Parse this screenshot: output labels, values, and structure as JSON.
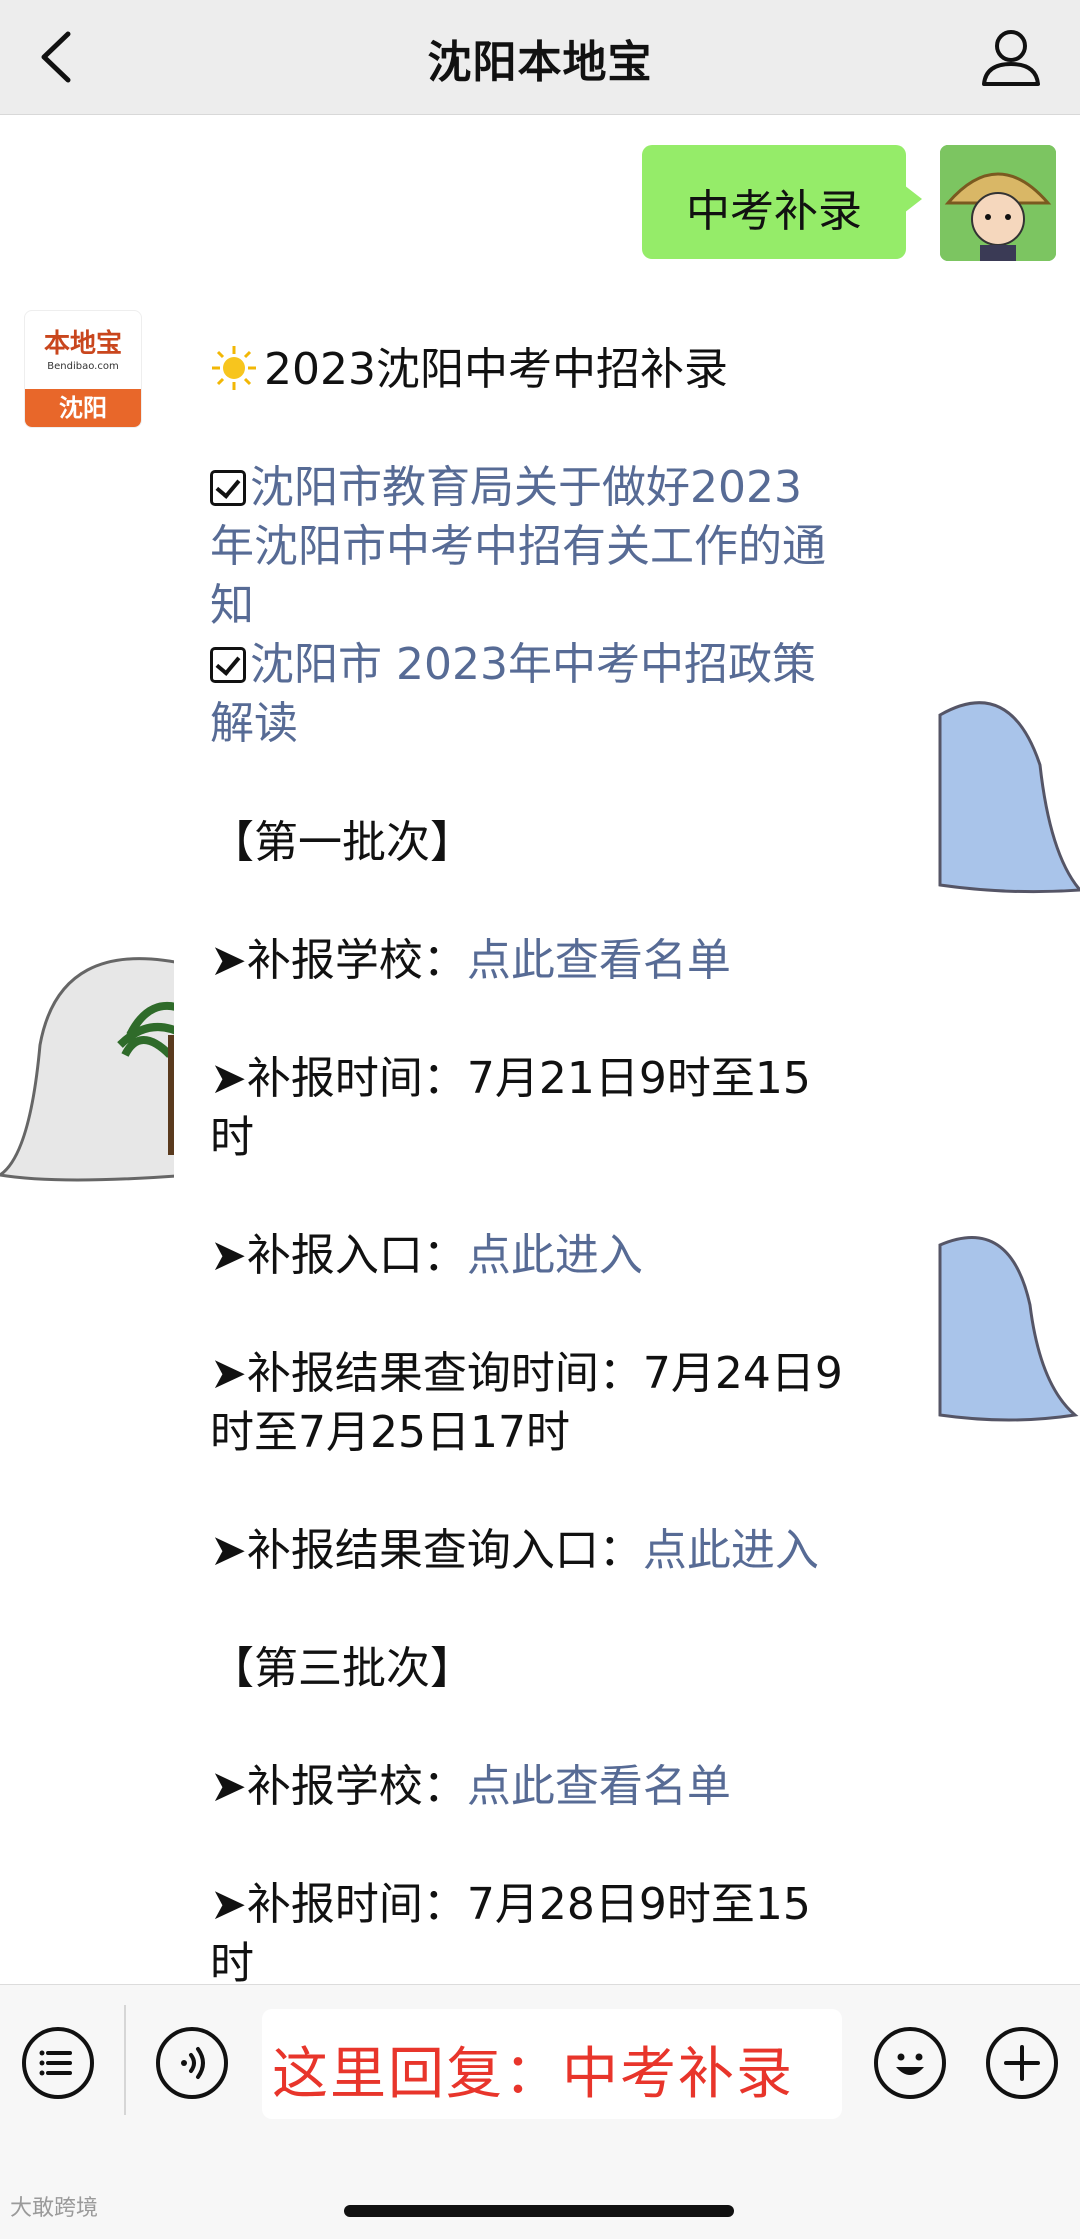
{
  "nav": {
    "title": "沈阳本地宝",
    "back_icon": "chevron-left-icon",
    "profile_icon": "user-icon"
  },
  "outgoing": {
    "text": "中考补录"
  },
  "bot": {
    "brand": "本地宝",
    "url": "Bendibao.com",
    "city": "沈阳"
  },
  "message": {
    "title": "2023沈阳中考中招补录",
    "links": [
      {
        "l1": "沈阳市教育局关于做好2023",
        "l2": "年沈阳市中考中招有关工作的通",
        "l3": "知"
      },
      {
        "l1": "沈阳市 2023年中考中招政策",
        "l2": "解读"
      }
    ],
    "batch1": {
      "header": "【第一批次】",
      "school_label": "➤补报学校：",
      "school_link": "点此查看名单",
      "time_l1": "➤补报时间：7月21日9时至15",
      "time_l2": "时",
      "entry_label": "➤补报入口：",
      "entry_link": "点此进入",
      "result_time_l1": "➤补报结果查询时间：7月24日9",
      "result_time_l2": "时至7月25日17时",
      "result_entry_label": "➤补报结果查询入口：",
      "result_entry_link": "点此进入"
    },
    "batch3": {
      "header": "【第三批次】",
      "school_label": "➤补报学校：",
      "school_link": "点此查看名单",
      "time_l1": "➤补报时间：7月28日9时至15",
      "time_l2": "时"
    }
  },
  "input_bar": {
    "text": "这里回复：中考补录",
    "menu_icon": "menu-list-icon",
    "voice_icon": "voice-icon",
    "emoji_icon": "emoji-icon",
    "plus_icon": "plus-icon"
  },
  "watermark": "大敢跨境",
  "colors": {
    "link": "#576b95",
    "bubble_green": "#95ec69",
    "reply_red": "#e8352b",
    "nav_bg": "#ededed"
  }
}
